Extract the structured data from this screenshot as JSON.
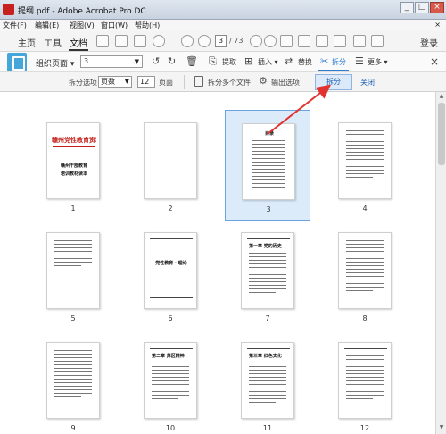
{
  "window": {
    "title": "提纲.pdf - Adobe Acrobat Pro DC",
    "min": "_",
    "max": "□",
    "close": "×"
  },
  "menu": {
    "items": [
      "文件(F)",
      "编辑(E)",
      "视图(V)",
      "窗口(W)",
      "帮助(H)"
    ],
    "close": "×"
  },
  "nav": {
    "home": "主页",
    "tools": "工具",
    "document": "文档",
    "page_current": "3",
    "page_total": "/ 73",
    "login": "登录"
  },
  "organize": {
    "title": "组织页面",
    "title_caret": "▾",
    "page_select": "3",
    "extract": "提取",
    "insert": "插入",
    "insert_caret": "▾",
    "replace": "替换",
    "split": "拆分",
    "more": "更多",
    "more_caret": "▾",
    "close": "×"
  },
  "split_bar": {
    "options_label": "拆分选项",
    "mode": "页数",
    "pages_value": "12",
    "pages_unit": "页面",
    "multi_files": "拆分多个文件",
    "output_options": "输出选项",
    "split_button": "拆分",
    "close_link": "关闭"
  },
  "thumbnails": [
    {
      "num": "1",
      "cover_title": "赣州党性教育资料",
      "cover_sub1": "赣州干部教育",
      "cover_sub2": "培训教材读本"
    },
    {
      "num": "2"
    },
    {
      "num": "3",
      "heading": "目录",
      "selected": true
    },
    {
      "num": "4"
    },
    {
      "num": "5"
    },
    {
      "num": "6",
      "heading": "党性教育 · 理论"
    },
    {
      "num": "7",
      "heading": "第一章 党的历史"
    },
    {
      "num": "8"
    },
    {
      "num": "9"
    },
    {
      "num": "10",
      "heading": "第二章 苏区精神"
    },
    {
      "num": "11",
      "heading": "第三章 红色文化"
    },
    {
      "num": "12"
    }
  ],
  "colors": {
    "accent": "#2d7cd1",
    "selection_fill": "#dcebfa",
    "arrow": "#e0332f",
    "cover_title": "#c3201b",
    "organize_icon": "#45a6d9"
  }
}
